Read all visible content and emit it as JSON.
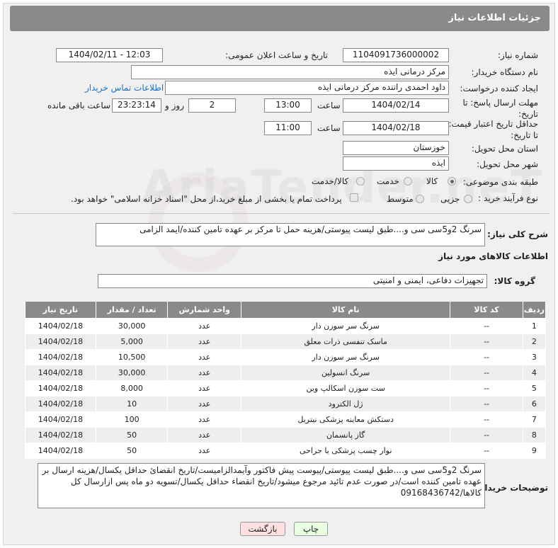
{
  "header": {
    "title": "جزئیات اطلاعات نیاز"
  },
  "fields": {
    "need_number_label": "شماره نیاز:",
    "need_number": "1104091736000002",
    "announce_label": "تاریخ و ساعت اعلان عمومی:",
    "announce_value": "1404/02/11 - 12:03",
    "buyer_org_label": "نام دستگاه خریدار:",
    "buyer_org": "مرکز درمانی ایذه",
    "creator_label": "ایجاد کننده درخواست:",
    "creator": "داود احمدی راننده مرکز درمانی ایذه",
    "contact_link": "اطلاعات تماس خریدار",
    "deadline_label": "مهلت ارسال پاسخ: تا تاریخ:",
    "deadline_date": "1404/02/14",
    "time_label": "ساعت",
    "deadline_time": "13:00",
    "days_value": "2",
    "days_label": "روز و",
    "remaining_value": "23:23:14",
    "remaining_label": "ساعت باقی مانده",
    "validity_label": "حداقل تاریخ اعتبار قیمت: تا تاریخ:",
    "validity_date": "1404/02/18",
    "validity_time": "11:00",
    "province_label": "استان محل تحویل:",
    "province": "خوزستان",
    "city_label": "شهر محل تحویل:",
    "city": "ایذه",
    "category_label": "طبقه بندی موضوعی:",
    "cat_goods": "کالا",
    "cat_service": "خدمت",
    "cat_goods_service": "کالا/خدمت",
    "process_label": "نوع فرآیند خرید :",
    "proc_minor": "جزیی",
    "proc_medium": "متوسط",
    "payment_note": "پرداخت تمام یا بخشی از مبلغ خرید،از محل \"اسناد خزانه اسلامی\" خواهد بود.",
    "summary_label": "شرح کلی نیاز:",
    "summary": "سرنگ 2و5سی سی و....طبق لیست پیوستی/هزینه حمل تا مرکز بر عهده تامین کننده/ایمد الزامی",
    "goods_info_title": "اطلاعات کالاهای مورد نیاز",
    "group_label": "گروه کالا:",
    "group_value": "تجهیزات دفاعی، ایمنی و امنیتی"
  },
  "table": {
    "headers": [
      "ردیف",
      "کد کالا",
      "نام کالا",
      "واحد شمارش",
      "تعداد / مقدار",
      "تاریخ نیاز"
    ],
    "rows": [
      [
        "1",
        "--",
        "سرنگ سر سوزن دار",
        "عدد",
        "30,000",
        "1404/02/18"
      ],
      [
        "2",
        "--",
        "ماسک تنفسی ذرات معلق",
        "عدد",
        "5,000",
        "1404/02/18"
      ],
      [
        "3",
        "--",
        "سرنگ سر سوزن دار",
        "عدد",
        "10,500",
        "1404/02/18"
      ],
      [
        "4",
        "--",
        "سرنگ انسولین",
        "عدد",
        "30,000",
        "1404/02/18"
      ],
      [
        "5",
        "--",
        "ست سوزن اسکالپ وین",
        "عدد",
        "8,000",
        "1404/02/18"
      ],
      [
        "6",
        "--",
        "ژل الکترود",
        "عدد",
        "10",
        "1404/02/18"
      ],
      [
        "7",
        "--",
        "دستکش معاینه پزشکی نیتریل",
        "عدد",
        "100",
        "1404/02/18"
      ],
      [
        "8",
        "--",
        "گاز پانسمان",
        "عدد",
        "50",
        "1404/02/18"
      ],
      [
        "9",
        "--",
        "نوار چسب پزشکی یا جراحی",
        "عدد",
        "50",
        "1404/02/18"
      ]
    ]
  },
  "notes": {
    "label": "توضیحات خریدار:",
    "text": "سرنگ 2و5سی سی و....طبق لیست پیوستی/پیوست پیش فاکتور وآیمدالزامیست/تاریخ انقضائ حداقل یکسال/هزینه ارسال بر عهده تامین کننده است/در صورت عدم تائید مرجوع میشود/تاریخ انقضاء حداقل یکسال/تسویه دو ماه پس ازارسال کل کالاها/09168436742"
  },
  "buttons": {
    "print": "چاپ",
    "back": "بازگشت"
  },
  "watermark": "AriaTender.neT"
}
